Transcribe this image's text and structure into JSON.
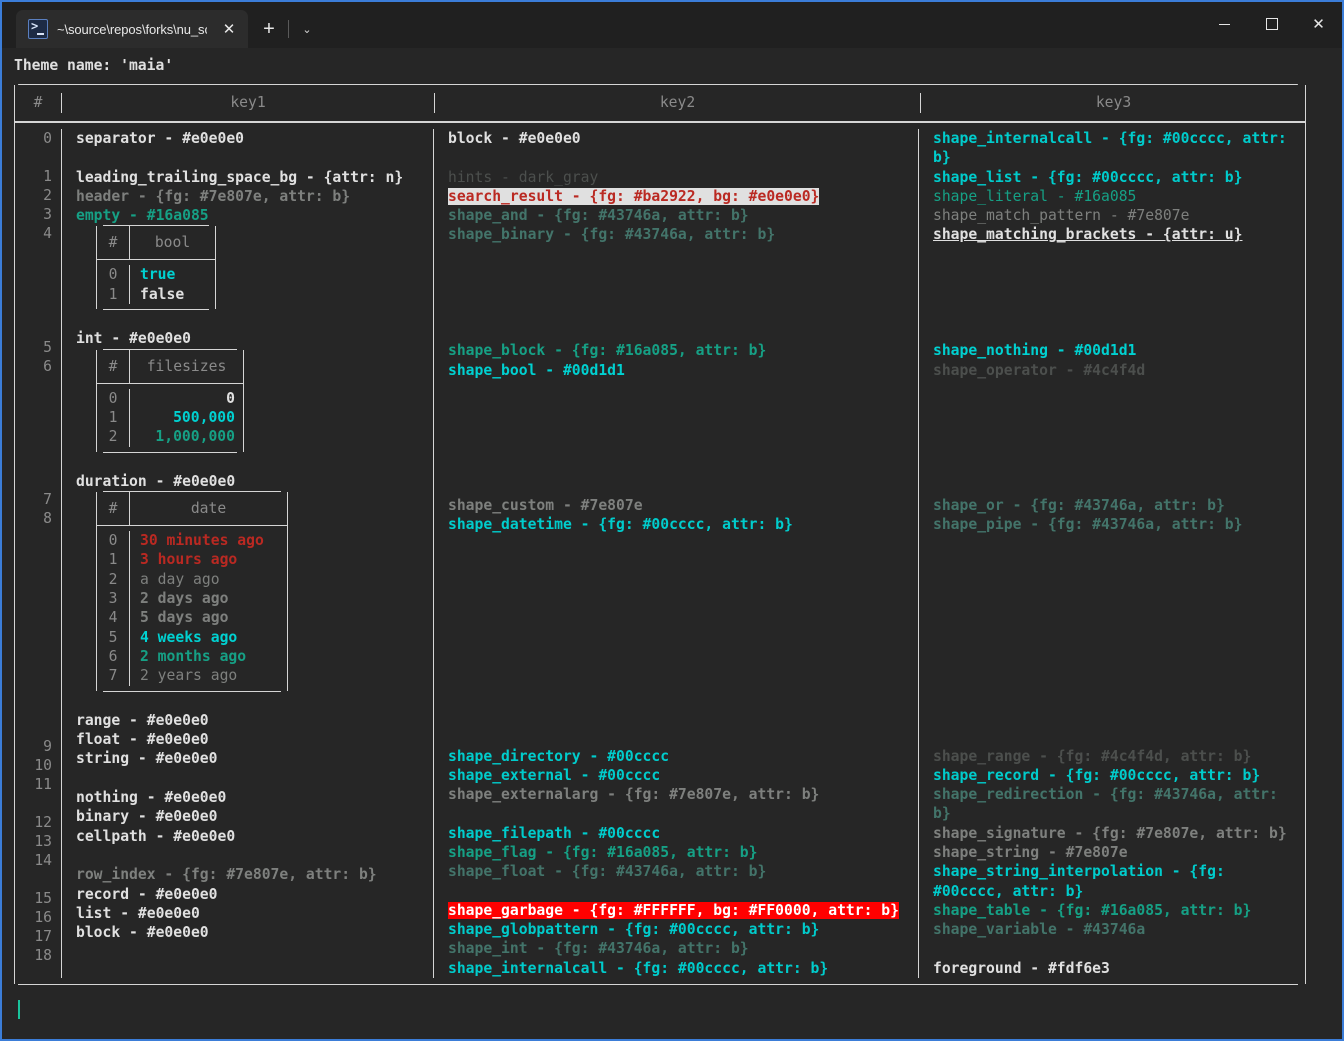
{
  "window": {
    "tab_title": "~\\source\\repos\\forks\\nu_scrip",
    "tab_icon": "powershell-icon",
    "close_label": "✕",
    "newtab_label": "+",
    "dropdown_label": "⌄",
    "minimize_label": "—",
    "maximize_label": "□",
    "window_close_label": "✕",
    "accent_color": "#3b7dd8",
    "titlebar_bg": "#202020",
    "terminal_bg": "#262626"
  },
  "terminal": {
    "theme_line": "Theme name: 'maia'",
    "cursor_color": "#19c39c"
  },
  "table": {
    "headers": {
      "index": "#",
      "key1": "key1",
      "key2": "key2",
      "key3": "key3"
    },
    "row_indices": [
      "0",
      "1",
      "2",
      "3",
      "4",
      "5",
      "6",
      "7",
      "8",
      "9",
      "10",
      "11",
      "12",
      "13",
      "14",
      "15",
      "16",
      "17",
      "18"
    ],
    "key1": [
      {
        "text": "separator - #e0e0e0",
        "style": "white"
      },
      {
        "text": "",
        "style": "blank"
      },
      {
        "text": "leading_trailing_space_bg - {attr: n}",
        "style": "white"
      },
      {
        "text": "header - {fg: #7e807e, attr: b}",
        "style": "graybold"
      },
      {
        "text": "empty - #16a085",
        "style": "teal"
      }
    ],
    "key1_bool_table": {
      "header_index": "#",
      "header_value": "bool",
      "rows": [
        {
          "i": "0",
          "v": "true",
          "style": "cyanbright"
        },
        {
          "i": "1",
          "v": "false",
          "style": "white"
        }
      ]
    },
    "key1_int_line": {
      "text": "int - #e0e0e0",
      "style": "white"
    },
    "key1_filesizes_table": {
      "header_index": "#",
      "header_value": "filesizes",
      "rows": [
        {
          "i": "0",
          "v": "0",
          "style": "white"
        },
        {
          "i": "1",
          "v": "500,000",
          "style": "cyanbright"
        },
        {
          "i": "2",
          "v": "1,000,000",
          "style": "teal"
        }
      ]
    },
    "key1_duration_line": {
      "text": "duration - #e0e0e0",
      "style": "white"
    },
    "key1_date_table": {
      "header_index": "#",
      "header_value": "date",
      "rows": [
        {
          "i": "0",
          "v": "30 minutes ago",
          "style": "red"
        },
        {
          "i": "1",
          "v": "3 hours ago",
          "style": "red"
        },
        {
          "i": "2",
          "v": "a day ago",
          "style": "gray"
        },
        {
          "i": "3",
          "v": "2 days ago",
          "style": "graybold"
        },
        {
          "i": "4",
          "v": "5 days ago",
          "style": "graybold"
        },
        {
          "i": "5",
          "v": "4 weeks ago",
          "style": "cyanbright"
        },
        {
          "i": "6",
          "v": "2 months ago",
          "style": "teal"
        },
        {
          "i": "7",
          "v": "2 years ago",
          "style": "gray"
        }
      ]
    },
    "key1_tail": [
      {
        "text": "range - #e0e0e0",
        "style": "white"
      },
      {
        "text": "float - #e0e0e0",
        "style": "white"
      },
      {
        "text": "string - #e0e0e0",
        "style": "white"
      },
      {
        "text": "",
        "style": "blank"
      },
      {
        "text": "nothing - #e0e0e0",
        "style": "white"
      },
      {
        "text": "binary - #e0e0e0",
        "style": "white"
      },
      {
        "text": "cellpath - #e0e0e0",
        "style": "white"
      },
      {
        "text": "",
        "style": "blank"
      },
      {
        "text": "row_index - {fg: #7e807e, attr: b}",
        "style": "graybold"
      },
      {
        "text": "record - #e0e0e0",
        "style": "white"
      },
      {
        "text": "list - #e0e0e0",
        "style": "white"
      },
      {
        "text": "block - #e0e0e0",
        "style": "white"
      }
    ],
    "key2": [
      {
        "text": "block - #e0e0e0",
        "style": "white"
      },
      {
        "text": "",
        "style": "blank"
      },
      {
        "text": "hints - dark_gray",
        "style": "dkgrayplain"
      },
      {
        "text": "search_result - {fg: #ba2922, bg: #e0e0e0}",
        "style": "hl-light"
      },
      {
        "text": "shape_and - {fg: #43746a, attr: b}",
        "style": "darkteal"
      },
      {
        "text": "shape_binary - {fg: #43746a, attr: b}",
        "style": "darkteal"
      },
      {
        "text": "",
        "style": "blank"
      },
      {
        "text": "",
        "style": "blank"
      },
      {
        "text": "",
        "style": "blank"
      },
      {
        "text": "",
        "style": "blank"
      },
      {
        "text": "",
        "style": "blank"
      },
      {
        "text": "shape_block - {fg: #16a085, attr: b}",
        "style": "teal"
      },
      {
        "text": "shape_bool - #00d1d1",
        "style": "cyanbright"
      },
      {
        "text": "",
        "style": "blank"
      },
      {
        "text": "",
        "style": "blank"
      },
      {
        "text": "",
        "style": "blank"
      },
      {
        "text": "",
        "style": "blank"
      },
      {
        "text": "",
        "style": "blank"
      },
      {
        "text": "",
        "style": "blank"
      },
      {
        "text": "shape_custom - #7e807e",
        "style": "graybold"
      },
      {
        "text": "shape_datetime - {fg: #00cccc, attr: b}",
        "style": "cyan"
      },
      {
        "text": "",
        "style": "blank"
      },
      {
        "text": "",
        "style": "blank"
      },
      {
        "text": "",
        "style": "blank"
      },
      {
        "text": "",
        "style": "blank"
      },
      {
        "text": "",
        "style": "blank"
      },
      {
        "text": "",
        "style": "blank"
      },
      {
        "text": "",
        "style": "blank"
      },
      {
        "text": "",
        "style": "blank"
      },
      {
        "text": "",
        "style": "blank"
      },
      {
        "text": "",
        "style": "blank"
      },
      {
        "text": "",
        "style": "blank"
      },
      {
        "text": "shape_directory - #00cccc",
        "style": "cyan"
      },
      {
        "text": "shape_external - #00cccc",
        "style": "cyan"
      },
      {
        "text": "shape_externalarg - {fg: #7e807e, attr: b}",
        "style": "graybold"
      },
      {
        "text": "",
        "style": "blank"
      },
      {
        "text": "shape_filepath - #00cccc",
        "style": "cyan"
      },
      {
        "text": "shape_flag - {fg: #16a085, attr: b}",
        "style": "teal"
      },
      {
        "text": "shape_float - {fg: #43746a, attr: b}",
        "style": "darkteal"
      },
      {
        "text": "",
        "style": "blank"
      },
      {
        "text": "shape_garbage - {fg: #FFFFFF, bg: #FF0000, attr: b}",
        "style": "hl-red"
      },
      {
        "text": "shape_globpattern - {fg: #00cccc, attr: b}",
        "style": "cyan"
      },
      {
        "text": "shape_int - {fg: #43746a, attr: b}",
        "style": "darkteal"
      },
      {
        "text": "shape_internalcall - {fg: #00cccc, attr: b}",
        "style": "cyan"
      }
    ],
    "key3": [
      {
        "text": "shape_internalcall - {fg: #00cccc, attr:",
        "style": "cyan"
      },
      {
        "text": "b}",
        "style": "cyan"
      },
      {
        "text": "shape_list - {fg: #00cccc, attr: b}",
        "style": "cyan"
      },
      {
        "text": "shape_literal - #16a085",
        "style": "tealdim"
      },
      {
        "text": "shape_match_pattern - #7e807e",
        "style": "gray"
      },
      {
        "text": "shape_matching_brackets - {attr: u}",
        "style": "uline"
      },
      {
        "text": "",
        "style": "blank"
      },
      {
        "text": "",
        "style": "blank"
      },
      {
        "text": "",
        "style": "blank"
      },
      {
        "text": "",
        "style": "blank"
      },
      {
        "text": "",
        "style": "blank"
      },
      {
        "text": "shape_nothing - #00d1d1",
        "style": "cyanbright"
      },
      {
        "text": "shape_operator - #4c4f4d",
        "style": "darkgray"
      },
      {
        "text": "",
        "style": "blank"
      },
      {
        "text": "",
        "style": "blank"
      },
      {
        "text": "",
        "style": "blank"
      },
      {
        "text": "",
        "style": "blank"
      },
      {
        "text": "",
        "style": "blank"
      },
      {
        "text": "",
        "style": "blank"
      },
      {
        "text": "shape_or - {fg: #43746a, attr: b}",
        "style": "darkteal"
      },
      {
        "text": "shape_pipe - {fg: #43746a, attr: b}",
        "style": "darkteal"
      },
      {
        "text": "",
        "style": "blank"
      },
      {
        "text": "",
        "style": "blank"
      },
      {
        "text": "",
        "style": "blank"
      },
      {
        "text": "",
        "style": "blank"
      },
      {
        "text": "",
        "style": "blank"
      },
      {
        "text": "",
        "style": "blank"
      },
      {
        "text": "",
        "style": "blank"
      },
      {
        "text": "",
        "style": "blank"
      },
      {
        "text": "",
        "style": "blank"
      },
      {
        "text": "",
        "style": "blank"
      },
      {
        "text": "",
        "style": "blank"
      },
      {
        "text": "shape_range - {fg: #4c4f4d, attr: b}",
        "style": "darkgray"
      },
      {
        "text": "shape_record - {fg: #00cccc, attr: b}",
        "style": "cyan"
      },
      {
        "text": "shape_redirection - {fg: #43746a, attr:",
        "style": "darkteal"
      },
      {
        "text": "b}",
        "style": "darkteal"
      },
      {
        "text": "shape_signature - {fg: #7e807e, attr: b}",
        "style": "graybold"
      },
      {
        "text": "shape_string - #7e807e",
        "style": "graybold"
      },
      {
        "text": "shape_string_interpolation - {fg:",
        "style": "cyan"
      },
      {
        "text": "#00cccc, attr: b}",
        "style": "cyan"
      },
      {
        "text": "shape_table - {fg: #16a085, attr: b}",
        "style": "teal"
      },
      {
        "text": "shape_variable - #43746a",
        "style": "darkteal"
      },
      {
        "text": "",
        "style": "blank"
      },
      {
        "text": "foreground - #fdf6e3",
        "style": "white"
      }
    ]
  }
}
